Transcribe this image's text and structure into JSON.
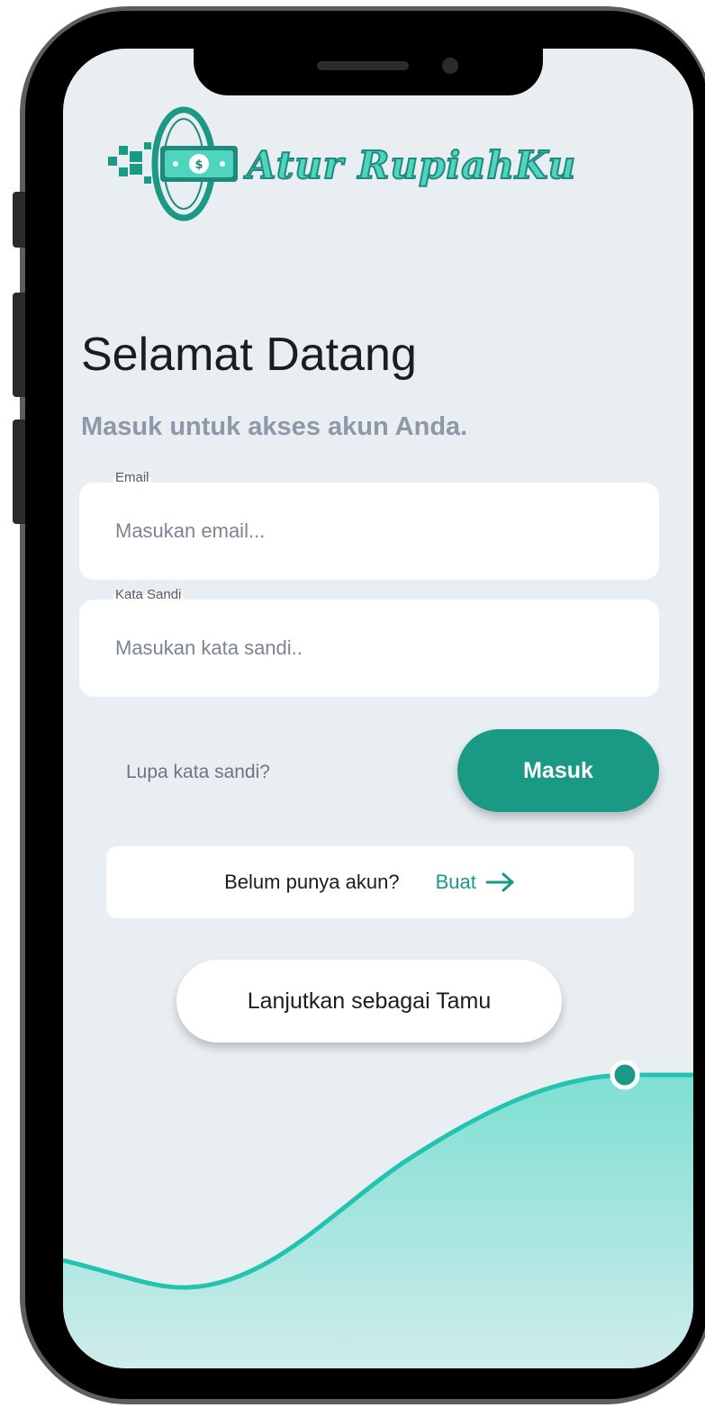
{
  "app": {
    "name": "Atur RupiahKu"
  },
  "login": {
    "heading": "Selamat Datang",
    "subheading": "Masuk untuk akses akun Anda.",
    "email_label": "Email",
    "email_placeholder": "Masukan email...",
    "password_label": "Kata Sandi",
    "password_placeholder": "Masukan kata sandi..",
    "forgot_label": "Lupa kata sandi?",
    "submit_label": "Masuk"
  },
  "signup": {
    "prompt": "Belum punya akun?",
    "link_label": "Buat"
  },
  "guest": {
    "label": "Lanjutkan sebagai Tamu"
  },
  "icons": {
    "logo": "money-bill-logo-icon",
    "arrow": "arrow-right-icon"
  },
  "colors": {
    "primary": "#1a9985",
    "accent": "#4fd4bf",
    "background": "#e9eef3"
  }
}
